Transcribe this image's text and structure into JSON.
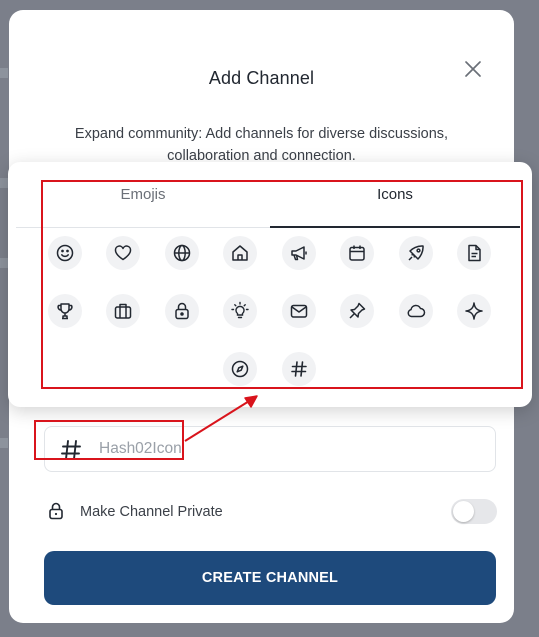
{
  "modal": {
    "title": "Add Channel",
    "description": "Expand community: Add channels for diverse discussions, collaboration and connection."
  },
  "picker": {
    "tabs": [
      {
        "label": "Emojis",
        "active": false
      },
      {
        "label": "Icons",
        "active": true
      }
    ],
    "icons": [
      "smile-icon",
      "heart-icon",
      "globe-icon",
      "home-icon",
      "megaphone-icon",
      "calendar-icon",
      "rocket-icon",
      "document-icon",
      "trophy-icon",
      "briefcase-icon",
      "lock-icon",
      "bulb-icon",
      "mail-icon",
      "pin-icon",
      "cloud-icon",
      "sparkle-icon",
      "compass-icon",
      "hash-icon"
    ]
  },
  "channel_name": {
    "placeholder": "Hash02Icon",
    "selected_icon": "hash-icon"
  },
  "private": {
    "label": "Make Channel Private",
    "enabled": false
  },
  "create_button": {
    "label": "CREATE CHANNEL"
  },
  "colors": {
    "primary": "#1e4a7c",
    "annotation": "#d9141c",
    "overlay": "#7b7f8a"
  }
}
